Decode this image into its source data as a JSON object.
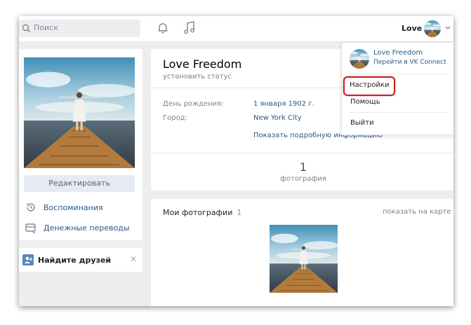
{
  "header": {
    "search_placeholder": "Поиск",
    "user_name": "Love"
  },
  "left": {
    "edit_button": "Редактировать",
    "menu": [
      {
        "label": "Воспоминания",
        "icon": "memories-icon"
      },
      {
        "label": "Денежные переводы",
        "icon": "money-transfer-icon"
      }
    ],
    "find_friends": "Найдите друзей"
  },
  "profile": {
    "name": "Love Freedom",
    "status": "установить статус",
    "birthday_label": "День рождения:",
    "birthday_value": "1 января 1902 г.",
    "city_label": "Город:",
    "city_value": "New York City",
    "more_info": "Показать подробную информацию",
    "photo_count": "1",
    "photo_count_label": "фотография"
  },
  "photos": {
    "title": "Мои фотографии",
    "count": "1",
    "map_link": "показать на карте"
  },
  "dropdown": {
    "name": "Love Freedom",
    "subtitle": "Перейти в VK Connect",
    "items": [
      "Настройки",
      "Помощь",
      "Выйти"
    ]
  },
  "colors": {
    "link": "#2a5885",
    "background": "#edeef0",
    "highlight": "#cc1d25",
    "button": "#e5ebf1"
  }
}
